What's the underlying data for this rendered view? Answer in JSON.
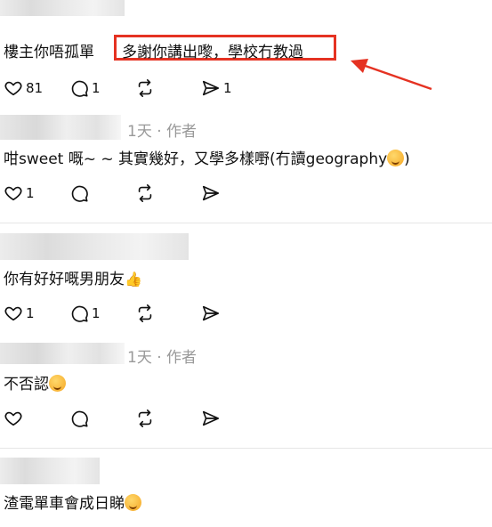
{
  "comment1": {
    "text": "樓主你唔孤單",
    "highlight": "多謝你講出嚟，學校冇教過",
    "likes": "81",
    "replies": "1",
    "shares": "1"
  },
  "comment2": {
    "meta": "1天 · 作者",
    "text": "咁sweet 嘅~ ~ 其實幾好，又學多樣嘢(冇讀geography",
    "text_end": ")",
    "likes": "1"
  },
  "comment3": {
    "text": "你有好好嘅男朋友",
    "likes": "1",
    "replies": "1"
  },
  "comment4": {
    "meta": "1天 · 作者",
    "text": "不否認"
  },
  "comment5": {
    "text": "渣電單車會成日睇"
  },
  "colors": {
    "highlight_border": "#e53222",
    "arrow": "#e53222",
    "meta": "#999999"
  },
  "icons": [
    "heart-icon",
    "comment-icon",
    "repost-icon",
    "share-icon"
  ]
}
